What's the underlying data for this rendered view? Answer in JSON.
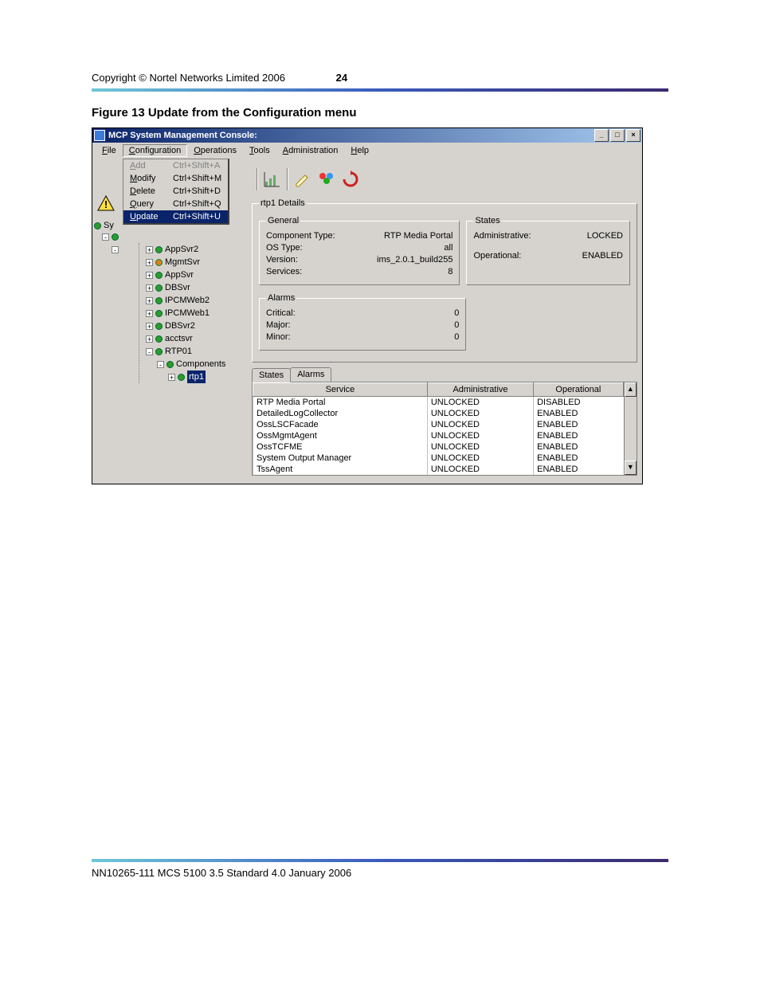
{
  "header": {
    "copyright": "Copyright © Nortel Networks Limited 2006",
    "page_num": "24"
  },
  "figure_title": "Figure 13  Update from the Configuration menu",
  "window": {
    "title": "MCP System Management Console:"
  },
  "window_controls": {
    "min": "_",
    "max": "□",
    "close": "×"
  },
  "menu": {
    "file": "File",
    "configuration": "Configuration",
    "operations": "Operations",
    "tools": "Tools",
    "administration": "Administration",
    "help": "Help"
  },
  "config_menu": [
    {
      "label": "Add",
      "shortcut": "Ctrl+Shift+A",
      "disabled": true,
      "active": false
    },
    {
      "label": "Modify",
      "shortcut": "Ctrl+Shift+M",
      "disabled": false,
      "active": false
    },
    {
      "label": "Delete",
      "shortcut": "Ctrl+Shift+D",
      "disabled": false,
      "active": false
    },
    {
      "label": "Query",
      "shortcut": "Ctrl+Shift+Q",
      "disabled": false,
      "active": false
    },
    {
      "label": "Update",
      "shortcut": "Ctrl+Shift+U",
      "disabled": false,
      "active": true
    }
  ],
  "tree_stubs": {
    "a": "Sy",
    "b": "",
    "c": ""
  },
  "tree": [
    {
      "exp": "+",
      "color": "green",
      "label": "AppSvr2",
      "indent": 1
    },
    {
      "exp": "+",
      "color": "orange",
      "label": "MgmtSvr",
      "indent": 1
    },
    {
      "exp": "+",
      "color": "green",
      "label": "AppSvr",
      "indent": 1
    },
    {
      "exp": "+",
      "color": "green",
      "label": "DBSvr",
      "indent": 1
    },
    {
      "exp": "+",
      "color": "green",
      "label": "IPCMWeb2",
      "indent": 1
    },
    {
      "exp": "+",
      "color": "green",
      "label": "IPCMWeb1",
      "indent": 1
    },
    {
      "exp": "+",
      "color": "green",
      "label": "DBSvr2",
      "indent": 1
    },
    {
      "exp": "+",
      "color": "green",
      "label": "acctsvr",
      "indent": 1
    },
    {
      "exp": "-",
      "color": "green",
      "label": "RTP01",
      "indent": 1
    },
    {
      "exp": "-",
      "color": "green",
      "label": "Components",
      "indent": 2
    },
    {
      "exp": "+",
      "color": "green",
      "label": "rtp1",
      "indent": 3,
      "selected": true
    }
  ],
  "details": {
    "title": "rtp1 Details",
    "general": {
      "legend": "General",
      "rows": [
        {
          "k": "Component Type:",
          "v": "RTP Media Portal"
        },
        {
          "k": "OS Type:",
          "v": "all"
        },
        {
          "k": "Version:",
          "v": "ims_2.0.1_build255"
        },
        {
          "k": "Services:",
          "v": "8"
        }
      ]
    },
    "states": {
      "legend": "States",
      "rows": [
        {
          "k": "Administrative:",
          "v": "LOCKED"
        },
        {
          "k": "Operational:",
          "v": "ENABLED"
        }
      ]
    },
    "alarms": {
      "legend": "Alarms",
      "rows": [
        {
          "k": "Critical:",
          "v": "0"
        },
        {
          "k": "Major:",
          "v": "0"
        },
        {
          "k": "Minor:",
          "v": "0"
        }
      ]
    }
  },
  "tabs": {
    "states": "States",
    "alarms": "Alarms"
  },
  "svc_table": {
    "headers": [
      "Service",
      "Administrative",
      "Operational"
    ],
    "rows": [
      [
        "RTP Media Portal",
        "UNLOCKED",
        "DISABLED"
      ],
      [
        "DetailedLogCollector",
        "UNLOCKED",
        "ENABLED"
      ],
      [
        "OssLSCFacade",
        "UNLOCKED",
        "ENABLED"
      ],
      [
        "OssMgmtAgent",
        "UNLOCKED",
        "ENABLED"
      ],
      [
        "OssTCFME",
        "UNLOCKED",
        "ENABLED"
      ],
      [
        "System Output Manager",
        "UNLOCKED",
        "ENABLED"
      ],
      [
        "TssAgent",
        "UNLOCKED",
        "ENABLED"
      ]
    ]
  },
  "scroll": {
    "up": "▲",
    "down": "▼"
  },
  "footer": "NN10265-111   MCS 5100 3.5   Standard   4.0   January 2006"
}
